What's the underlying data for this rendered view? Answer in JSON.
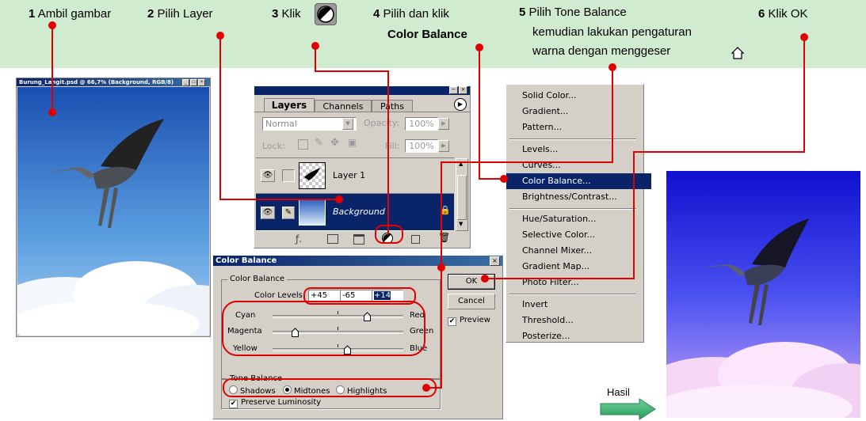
{
  "banner": {
    "steps": [
      {
        "num": "1",
        "text": "Ambil gambar"
      },
      {
        "num": "2",
        "text": "Pilih Layer"
      },
      {
        "num": "3",
        "text": "Klik"
      },
      {
        "num": "4",
        "text": "Pilih dan klik",
        "bold": "Color Balance"
      },
      {
        "num": "5",
        "text": "Pilih Tone Balance",
        "line2": "kemudian lakukan pengaturan",
        "line3": "warna dengan menggeser"
      },
      {
        "num": "6",
        "text": "Klik OK"
      }
    ]
  },
  "image_window": {
    "title": "Burung_Langit.psd @ 66,7% (Background, RGB/8)"
  },
  "layers_panel": {
    "tabs": [
      "Layers",
      "Channels",
      "Paths"
    ],
    "blend_mode": "Normal",
    "opacity_label": "Opacity:",
    "opacity_value": "100%",
    "lock_label": "Lock:",
    "fill_label": "Fill:",
    "fill_value": "100%",
    "layers": [
      {
        "name": "Layer 1"
      },
      {
        "name": "Background"
      }
    ]
  },
  "menu": {
    "groups": [
      [
        "Solid Color...",
        "Gradient...",
        "Pattern..."
      ],
      [
        "Levels...",
        "Curves...",
        "Color Balance...",
        "Brightness/Contrast..."
      ],
      [
        "Hue/Saturation...",
        "Selective Color...",
        "Channel Mixer...",
        "Gradient Map...",
        "Photo Filter..."
      ],
      [
        "Invert",
        "Threshold...",
        "Posterize..."
      ]
    ],
    "selected": "Color Balance..."
  },
  "dialog": {
    "title": "Color Balance",
    "color_balance_group": "Color Balance",
    "color_levels_label": "Color Levels:",
    "levels": [
      "+45",
      "-65",
      "+14"
    ],
    "sliders": [
      {
        "left": "Cyan",
        "right": "Red",
        "value": 45
      },
      {
        "left": "Magenta",
        "right": "Green",
        "value": -65
      },
      {
        "left": "Yellow",
        "right": "Blue",
        "value": 14
      }
    ],
    "ok_label": "OK",
    "cancel_label": "Cancel",
    "preview_label": "Preview",
    "tone_group": "Tone Balance",
    "tones": [
      "Shadows",
      "Midtones",
      "Highlights"
    ],
    "selected_tone": "Midtones",
    "preserve_label": "Preserve Luminosity"
  },
  "result": {
    "label": "Hasil"
  },
  "colors": {
    "annotation": "#e00000",
    "banner": "#d0ebd0",
    "selection": "#0a246a"
  }
}
